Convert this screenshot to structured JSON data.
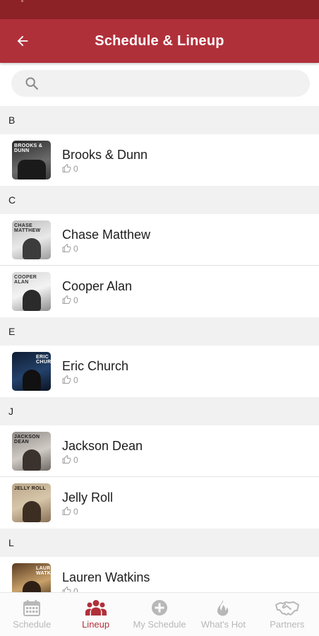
{
  "header": {
    "title": "Schedule & Lineup",
    "back_icon": "arrow-left-icon"
  },
  "search": {
    "value": "",
    "placeholder": "",
    "icon": "search-icon"
  },
  "colors": {
    "primary": "#b0303a",
    "status_bar": "#8c2126",
    "inactive": "#b8b8b8"
  },
  "sections": [
    {
      "letter": "B",
      "artists": [
        {
          "name": "Brooks & Dunn",
          "likes": "0",
          "thumb_text": "BROOKS & DUNN"
        }
      ]
    },
    {
      "letter": "C",
      "artists": [
        {
          "name": "Chase Matthew",
          "likes": "0",
          "thumb_text": "CHASE MATTHEW"
        },
        {
          "name": "Cooper Alan",
          "likes": "0",
          "thumb_text": "COOPER ALAN"
        }
      ]
    },
    {
      "letter": "E",
      "artists": [
        {
          "name": "Eric Church",
          "likes": "0",
          "thumb_text": "ERIC CHURCH"
        }
      ]
    },
    {
      "letter": "J",
      "artists": [
        {
          "name": "Jackson Dean",
          "likes": "0",
          "thumb_text": "JACKSON DEAN"
        },
        {
          "name": "Jelly Roll",
          "likes": "0",
          "thumb_text": "JELLY ROLL"
        }
      ]
    },
    {
      "letter": "L",
      "artists": [
        {
          "name": "Lauren Watkins",
          "likes": "0",
          "thumb_text": "LAUREN WATKINS"
        }
      ]
    }
  ],
  "nav": [
    {
      "label": "Schedule",
      "icon": "calendar-icon",
      "active": false
    },
    {
      "label": "Lineup",
      "icon": "people-icon",
      "active": true
    },
    {
      "label": "My Schedule",
      "icon": "plus-circle-icon",
      "active": false
    },
    {
      "label": "What's Hot",
      "icon": "flame-icon",
      "active": false
    },
    {
      "label": "Partners",
      "icon": "handshake-icon",
      "active": false
    }
  ]
}
